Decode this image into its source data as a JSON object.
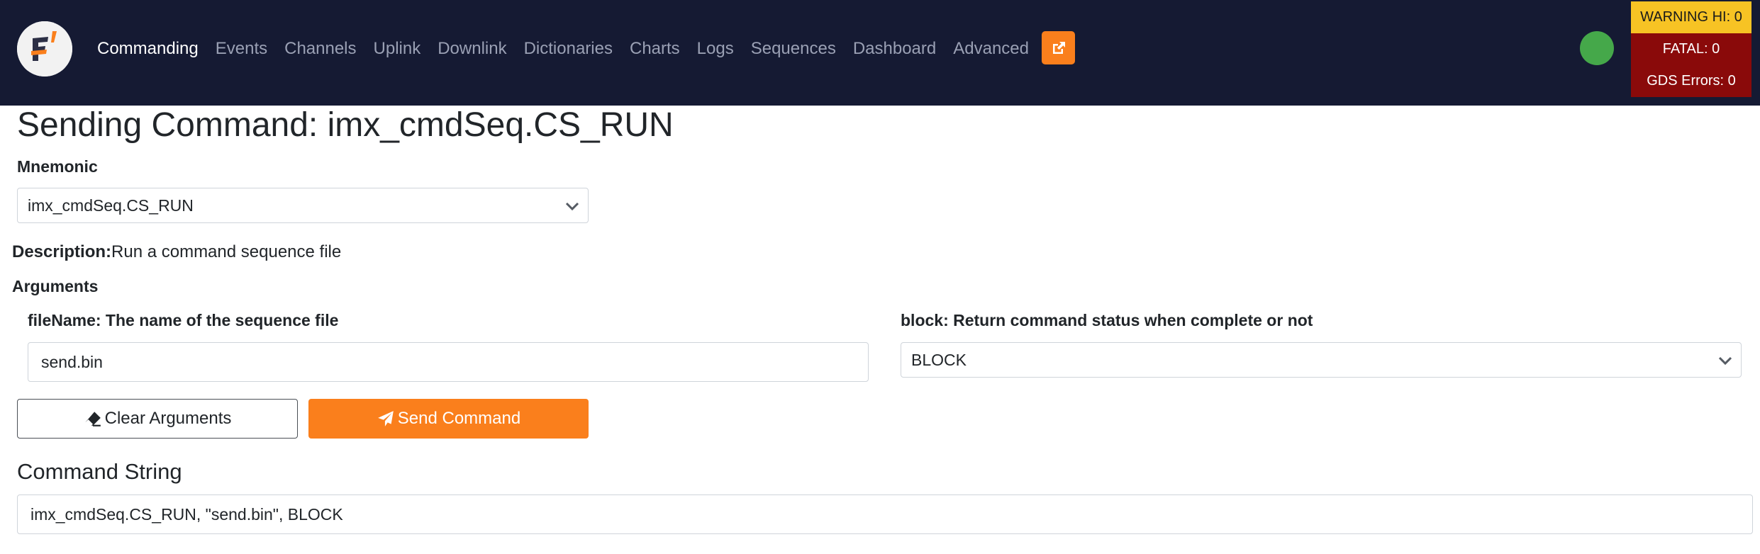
{
  "nav": {
    "logo": "fprime-logo",
    "links": [
      {
        "label": "Commanding",
        "active": true
      },
      {
        "label": "Events"
      },
      {
        "label": "Channels"
      },
      {
        "label": "Uplink"
      },
      {
        "label": "Downlink"
      },
      {
        "label": "Dictionaries"
      },
      {
        "label": "Charts"
      },
      {
        "label": "Logs"
      },
      {
        "label": "Sequences"
      },
      {
        "label": "Dashboard"
      },
      {
        "label": "Advanced"
      }
    ],
    "external_icon": "external-link-icon",
    "status_color": "#45a84a",
    "alerts": {
      "warning": "WARNING HI: 0",
      "fatal": "FATAL: 0",
      "gds_errors": "GDS Errors: 0"
    }
  },
  "main": {
    "title": "Sending Command: imx_cmdSeq.CS_RUN",
    "mnemonic_label": "Mnemonic",
    "mnemonic_value": "imx_cmdSeq.CS_RUN",
    "description_label": "Description:",
    "description_text": "Run a command sequence file",
    "arguments_label": "Arguments",
    "args": {
      "filename_label": "fileName: The name of the sequence file",
      "filename_value": "send.bin",
      "block_label": "block: Return command status when complete or not",
      "block_value": "BLOCK"
    },
    "buttons": {
      "clear": "Clear Arguments",
      "send": "Send Command"
    },
    "command_string_label": "Command String",
    "command_string_value": "imx_cmdSeq.CS_RUN, \"send.bin\", BLOCK"
  },
  "colors": {
    "navbar": "#151a33",
    "accent": "#fa7f1c",
    "warning": "#f7c324",
    "error": "#8a0a0a"
  }
}
